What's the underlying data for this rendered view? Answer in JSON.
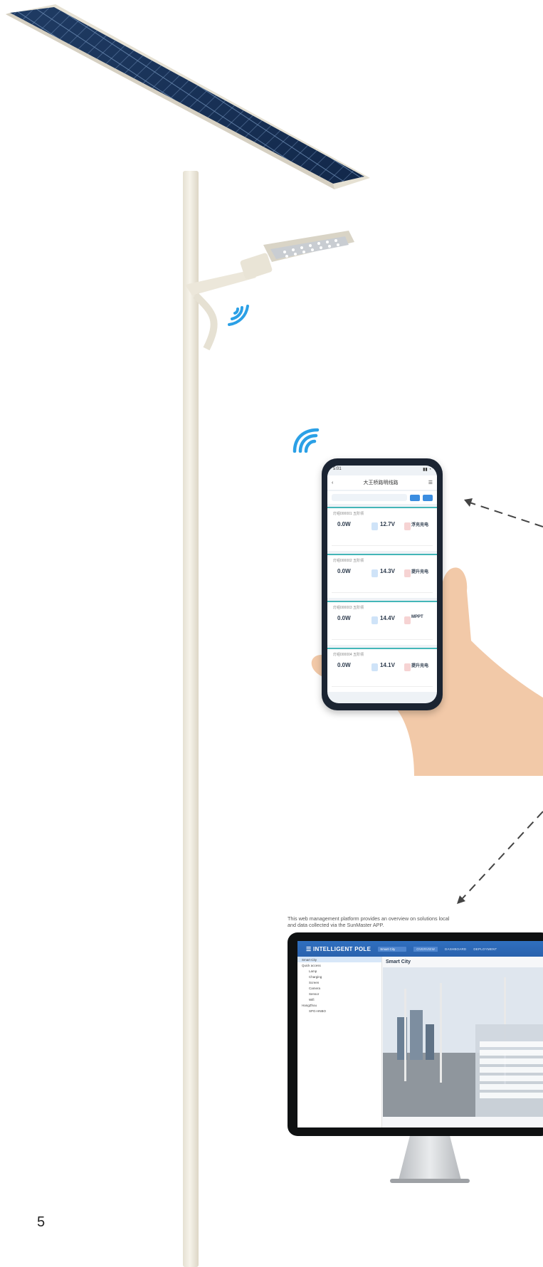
{
  "caption": {
    "line1": "This web management platform provides an overview on solutions local",
    "line2": "and data collected via the SunMaster APP."
  },
  "page_number": "5",
  "phone": {
    "title": "大王桥路明线路",
    "cards": [
      {
        "id": "灯组000001  五阶领",
        "power": "0.0W",
        "voltage": "12.7V",
        "status": "浮充充电"
      },
      {
        "id": "灯组000002  五阶领",
        "power": "0.0W",
        "voltage": "14.3V",
        "status": "提升充电"
      },
      {
        "id": "灯组000003  五阶领",
        "power": "0.0W",
        "voltage": "14.4V",
        "status": "MPPT"
      },
      {
        "id": "灯组000004  五阶领",
        "power": "0.0W",
        "voltage": "14.1V",
        "status": "提升充电"
      }
    ]
  },
  "monitor": {
    "app_title": "INTELLIGENT POLE",
    "city_select": "Smart City",
    "nav": [
      "OVERVIEW",
      "DASHBOARD",
      "DEPLOYMENT"
    ],
    "heading": "Smart City",
    "tree": [
      "Smart City",
      "Quick access",
      "Lamp",
      "Charging",
      "Screen",
      "Camera",
      "Sensor",
      "Wifi",
      "HangZhou",
      "SPG-HNBO"
    ]
  },
  "colors": {
    "accent_blue": "#3b8de0",
    "wifi_blue": "#2ba0e6",
    "pole": "#eee9dc"
  }
}
